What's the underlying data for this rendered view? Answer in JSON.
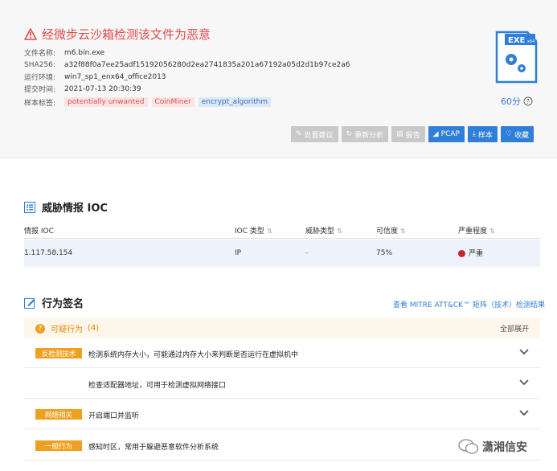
{
  "summary": {
    "verdict": "经微步云沙箱检测该文件为恶意",
    "meta": [
      {
        "key": "文件名称:",
        "value": "m6.bin.exe"
      },
      {
        "key": "SHA256:",
        "value": "a32f88f0a7ee25adf15192056280d2ea2741835a201a67192a05d2d1b97ce2a6"
      },
      {
        "key": "运行环境:",
        "value": "win7_sp1_enx64_office2013"
      },
      {
        "key": "提交时间:",
        "value": "2021-07-13 20:30:39"
      }
    ],
    "tags_label": "样本标签:",
    "tags": [
      {
        "text": "potentially unwanted",
        "color": "red"
      },
      {
        "text": "CoinMiner",
        "color": "red"
      },
      {
        "text": "encrypt_algorithm",
        "color": "blue"
      }
    ],
    "file_icon_label": "EXE",
    "file_icon_sub": "x64",
    "score": "60分"
  },
  "toolbar": {
    "buttons": [
      {
        "label": "处置建议",
        "style": "dis"
      },
      {
        "label": "重新分析",
        "style": "dis"
      },
      {
        "label": "报告",
        "style": "dis"
      },
      {
        "label": "PCAP",
        "style": "pri"
      },
      {
        "label": "样本",
        "style": "pri"
      },
      {
        "label": "收藏",
        "style": "pri"
      }
    ]
  },
  "threat_intel": {
    "title": "威胁情报 IOC",
    "columns": [
      "情报 IOC",
      "IOC 类型",
      "威胁类型",
      "可信度",
      "严重程度"
    ],
    "rows": [
      {
        "ioc": "1.117.58.154",
        "type": "IP",
        "threat": "-",
        "confidence": "75%",
        "severity": "严重"
      }
    ]
  },
  "behavior": {
    "title": "行为签名",
    "mitre_link": "查看 MITRE ATT&CK™ 矩阵（技术）检测结果",
    "suspicious_label": "可疑行为",
    "suspicious_count": "(4)",
    "expand_all": "全部展开",
    "items": [
      {
        "badge": "反检测技术",
        "text": "检测系统内存大小，可能通过内存大小来判断是否运行在虚拟机中"
      },
      {
        "badge": "",
        "text": "检查适配器地址，可用于检测虚拟网络接口"
      },
      {
        "badge": "网络相关",
        "text": "开启端口并监听"
      },
      {
        "badge": "一般行为",
        "text": "感知时区，常用于躲避恶意软件分析系统"
      }
    ]
  },
  "watermark": "潇湘信安",
  "colors": {
    "danger": "#e24a4a",
    "primary": "#2f7ed8",
    "warning": "#f0a020"
  }
}
